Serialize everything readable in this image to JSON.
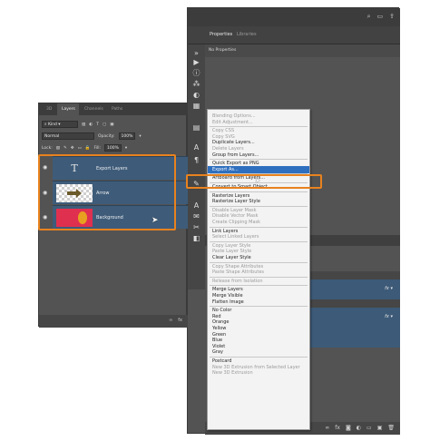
{
  "properties_panel": {
    "tabs": [
      "Properties",
      "Libraries"
    ],
    "no_properties": "No Properties"
  },
  "layers_panel": {
    "tabs": [
      "3D",
      "Layers",
      "Channels",
      "Paths"
    ],
    "filter_kind": "Kind",
    "blend_mode": "Normal",
    "opacity_label": "Opacity:",
    "opacity_value": "100%",
    "lock_label": "Lock:",
    "fill_label": "Fill:",
    "fill_value": "100%",
    "layers": [
      {
        "name": "Export Layers",
        "thumb": "text"
      },
      {
        "name": "Arrow",
        "thumb": "checker"
      },
      {
        "name": "Background",
        "thumb": "bg"
      }
    ]
  },
  "context_menu": {
    "items": [
      {
        "label": "Blending Options...",
        "state": "disabled"
      },
      {
        "label": "Edit Adjustment...",
        "state": "disabled"
      },
      {
        "sep": true
      },
      {
        "label": "Copy CSS",
        "state": "disabled"
      },
      {
        "label": "Copy SVG",
        "state": "disabled"
      },
      {
        "label": "Duplicate Layers...",
        "state": "enabled"
      },
      {
        "label": "Delete Layers",
        "state": "disabled"
      },
      {
        "label": "Group from Layers...",
        "state": "enabled"
      },
      {
        "sep": true
      },
      {
        "label": "Quick Export as PNG",
        "state": "enabled"
      },
      {
        "label": "Export As...",
        "state": "selected"
      },
      {
        "sep": true
      },
      {
        "label": "Artboard from Layers...",
        "state": "enabled"
      },
      {
        "sep": true
      },
      {
        "label": "Convert to Smart Object",
        "state": "enabled"
      },
      {
        "sep": true
      },
      {
        "label": "Rasterize Layers",
        "state": "enabled"
      },
      {
        "label": "Rasterize Layer Style",
        "state": "enabled"
      },
      {
        "sep": true
      },
      {
        "label": "Disable Layer Mask",
        "state": "disabled"
      },
      {
        "label": "Disable Vector Mask",
        "state": "disabled"
      },
      {
        "label": "Create Clipping Mask",
        "state": "disabled"
      },
      {
        "sep": true
      },
      {
        "label": "Link Layers",
        "state": "enabled"
      },
      {
        "label": "Select Linked Layers",
        "state": "disabled"
      },
      {
        "sep": true
      },
      {
        "label": "Copy Layer Style",
        "state": "disabled"
      },
      {
        "label": "Paste Layer Style",
        "state": "disabled"
      },
      {
        "label": "Clear Layer Style",
        "state": "enabled"
      },
      {
        "sep": true
      },
      {
        "label": "Copy Shape Attributes",
        "state": "disabled"
      },
      {
        "label": "Paste Shape Attributes",
        "state": "disabled"
      },
      {
        "sep": true
      },
      {
        "label": "Release from Isolation",
        "state": "disabled"
      },
      {
        "sep": true
      },
      {
        "label": "Merge Layers",
        "state": "enabled"
      },
      {
        "label": "Merge Visible",
        "state": "enabled"
      },
      {
        "label": "Flatten Image",
        "state": "enabled"
      },
      {
        "sep": true
      },
      {
        "label": "No Color",
        "state": "enabled"
      },
      {
        "label": "Red",
        "state": "enabled"
      },
      {
        "label": "Orange",
        "state": "enabled"
      },
      {
        "label": "Yellow",
        "state": "enabled"
      },
      {
        "label": "Green",
        "state": "enabled"
      },
      {
        "label": "Blue",
        "state": "enabled"
      },
      {
        "label": "Violet",
        "state": "enabled"
      },
      {
        "label": "Gray",
        "state": "enabled"
      },
      {
        "sep": true
      },
      {
        "label": "Postcard",
        "state": "enabled"
      },
      {
        "label": "New 3D Extrusion from Selected Layer",
        "state": "disabled"
      },
      {
        "label": "New 3D Extrusion",
        "state": "disabled"
      }
    ]
  },
  "colors": {
    "highlight": "#e8821e",
    "menu_selected": "#2f6fbf",
    "layer_selected": "#3e5c7a"
  }
}
